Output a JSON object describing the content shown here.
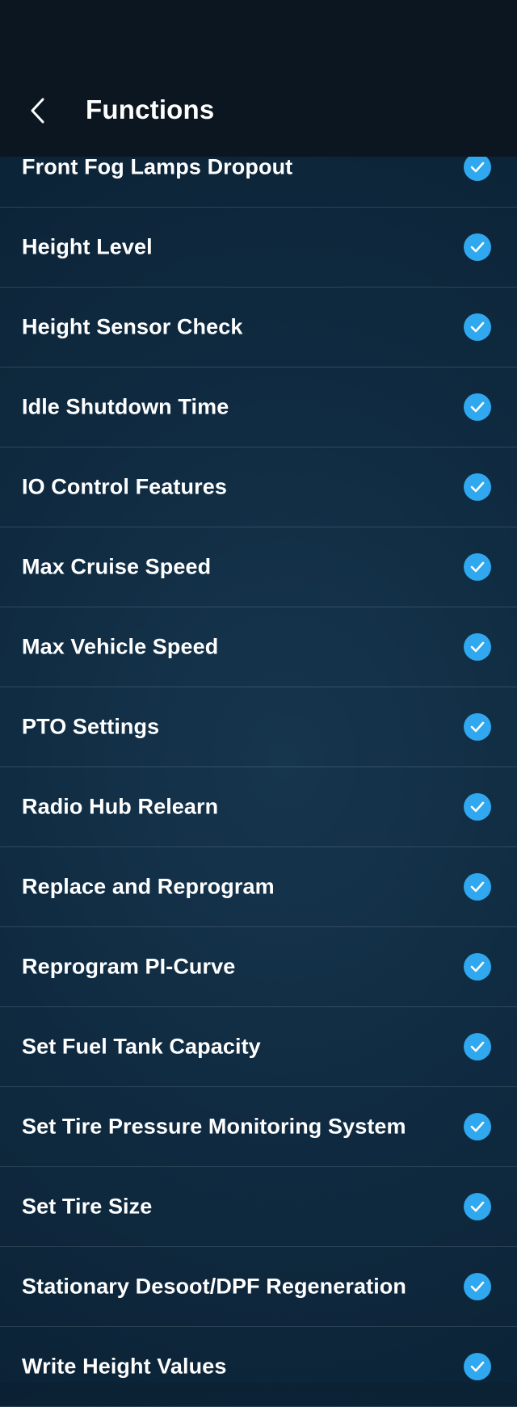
{
  "header": {
    "title": "Functions",
    "back_icon": "chevron-left-icon"
  },
  "colors": {
    "accent": "#2fa8ef",
    "header_bg": "#0b1620",
    "list_bg": "#0f2a40"
  },
  "functions": [
    {
      "label": "Front Fog Lamps Dropout",
      "checked": true
    },
    {
      "label": "Height Level",
      "checked": true
    },
    {
      "label": "Height Sensor Check",
      "checked": true
    },
    {
      "label": "Idle Shutdown Time",
      "checked": true
    },
    {
      "label": "IO Control Features",
      "checked": true
    },
    {
      "label": "Max Cruise Speed",
      "checked": true
    },
    {
      "label": "Max Vehicle Speed",
      "checked": true
    },
    {
      "label": "PTO Settings",
      "checked": true
    },
    {
      "label": "Radio Hub Relearn",
      "checked": true
    },
    {
      "label": "Replace and Reprogram",
      "checked": true
    },
    {
      "label": "Reprogram PI-Curve",
      "checked": true
    },
    {
      "label": "Set Fuel Tank Capacity",
      "checked": true
    },
    {
      "label": "Set Tire Pressure Monitoring System",
      "checked": true
    },
    {
      "label": "Set Tire Size",
      "checked": true
    },
    {
      "label": "Stationary Desoot/DPF Regeneration",
      "checked": true
    },
    {
      "label": "Write Height Values",
      "checked": true
    }
  ]
}
